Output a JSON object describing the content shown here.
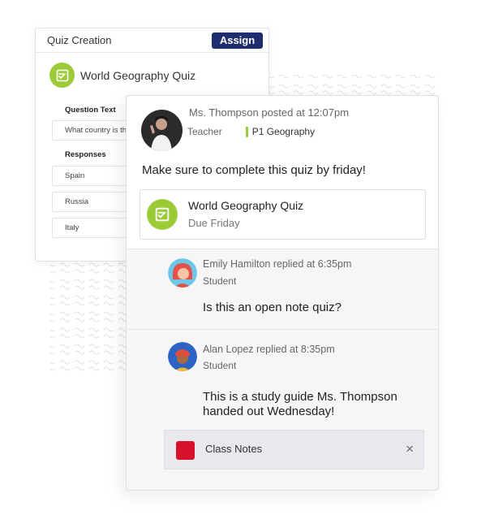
{
  "quiz_creation": {
    "header_title": "Quiz Creation",
    "assign_label": "Assign",
    "quiz_title": "World Geography Quiz",
    "question_label": "Question Text",
    "question_value": "What country is th",
    "responses_label": "Responses",
    "responses": [
      "Spain",
      "Russia",
      "Italy"
    ]
  },
  "post": {
    "poster_line": "Ms. Thompson posted at 12:07pm",
    "role": "Teacher",
    "class_tag": "P1 Geography",
    "message": "Make sure to complete this quiz by friday!",
    "attachment": {
      "title": "World Geography Quiz",
      "due": "Due Friday"
    }
  },
  "replies": [
    {
      "header": "Emily Hamilton replied at 6:35pm",
      "role": "Student",
      "text": "Is this an open note quiz?"
    },
    {
      "header": "Alan Lopez replied at 8:35pm",
      "role": "Student",
      "text_line1": "This is a study guide Ms. Thompson",
      "text_line2": "handed out Wednesday!",
      "attachment_label": "Class Notes",
      "attachment_close": "×"
    }
  ],
  "icons": {
    "quiz": "quiz-doc-icon",
    "notes": "notes-file-icon",
    "close": "close-icon"
  },
  "colors": {
    "accent_green": "#9ccb3a",
    "assign_navy": "#1f2d6e",
    "notes_red": "#d7102c"
  }
}
